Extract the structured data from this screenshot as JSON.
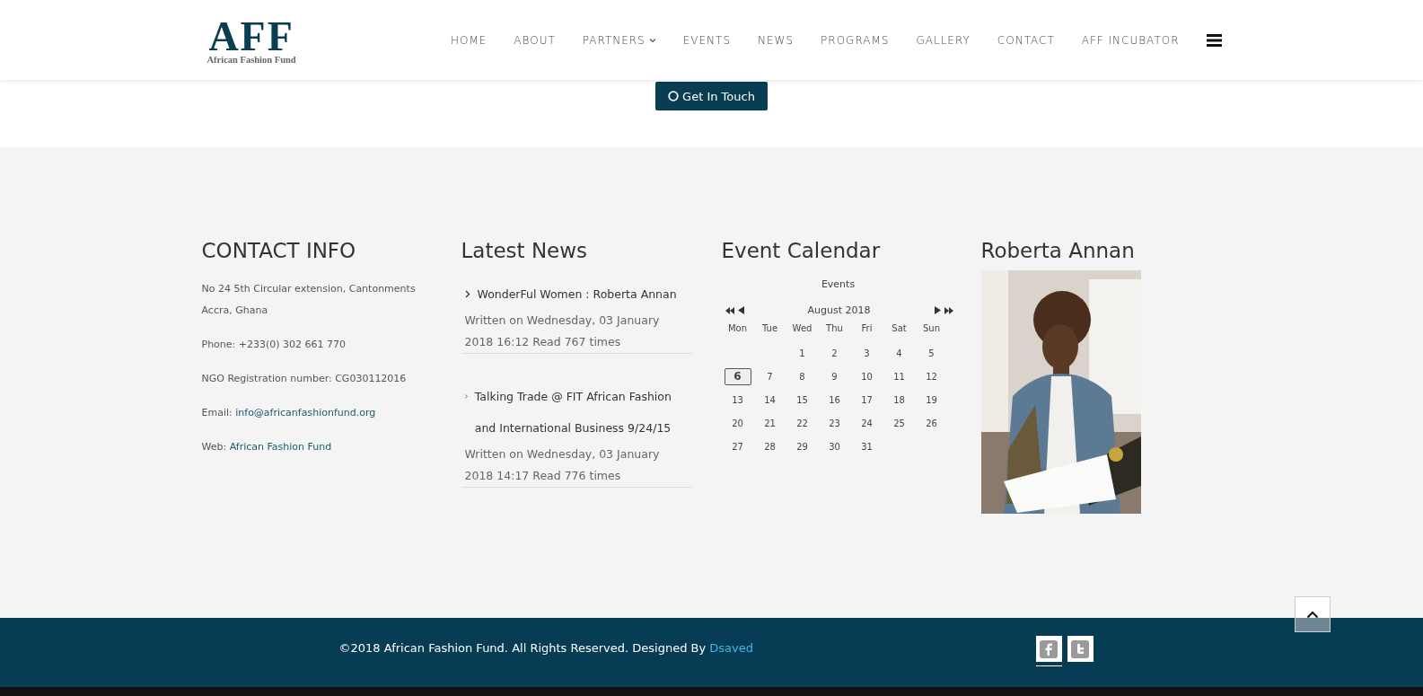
{
  "header": {
    "logo": {
      "mark": "AFF",
      "tagline": "African Fashion Fund"
    },
    "nav": [
      {
        "label": "HOME",
        "dropdown": false
      },
      {
        "label": "ABOUT",
        "dropdown": false
      },
      {
        "label": "PARTNERS",
        "dropdown": true
      },
      {
        "label": "EVENTS",
        "dropdown": false
      },
      {
        "label": "NEWS",
        "dropdown": false
      },
      {
        "label": "PROGRAMS",
        "dropdown": false
      },
      {
        "label": "GALLERY",
        "dropdown": false
      },
      {
        "label": "CONTACT",
        "dropdown": false
      },
      {
        "label": "AFF INCUBATOR",
        "dropdown": false
      }
    ]
  },
  "cta": {
    "label": "Get In Touch"
  },
  "contact": {
    "title": "CONTACT INFO",
    "lines": [
      {
        "text": "No 24 5th Circular extension, Cantonments Accra, Ghana"
      },
      {
        "text": "Phone: +233(0) 302 661 770"
      },
      {
        "text": "NGO Registration number: CG030112016"
      },
      {
        "text": "Email:",
        "link": "info@africanfashionfund.org"
      },
      {
        "text": "Web:",
        "link": "African Fashion Fund"
      }
    ]
  },
  "news": {
    "title": "Latest News",
    "items": [
      {
        "title": "WonderFul Women : Roberta Annan",
        "meta": "Written on Wednesday, 03 January 2018 16:12 Read 767 times"
      },
      {
        "title": "Talking Trade @ FIT African Fashion and International Business 9/24/15",
        "meta": "Written on Wednesday, 03 January 2018 14:17 Read 776 times"
      }
    ]
  },
  "calendar": {
    "title": "Event Calendar",
    "caption": "Events",
    "month": "August 2018",
    "weekdays": [
      "Mon",
      "Tue",
      "Wed",
      "Thu",
      "Fri",
      "Sat",
      "Sun"
    ],
    "weeks": [
      [
        {
          "kind": "empty"
        },
        {
          "kind": "empty"
        },
        {
          "kind": "day",
          "day": "1",
          "selected": false
        },
        {
          "kind": "day",
          "day": "2",
          "selected": false
        },
        {
          "kind": "day",
          "day": "3",
          "selected": false
        },
        {
          "kind": "day",
          "day": "4",
          "selected": false
        },
        {
          "kind": "day",
          "day": "5",
          "selected": false
        }
      ],
      [
        {
          "kind": "day",
          "day": "6",
          "selected": true
        },
        {
          "kind": "day",
          "day": "7",
          "selected": false
        },
        {
          "kind": "day",
          "day": "8",
          "selected": false
        },
        {
          "kind": "day",
          "day": "9",
          "selected": false
        },
        {
          "kind": "day",
          "day": "10",
          "selected": false
        },
        {
          "kind": "day",
          "day": "11",
          "selected": false
        },
        {
          "kind": "day",
          "day": "12",
          "selected": false
        }
      ],
      [
        {
          "kind": "day",
          "day": "13",
          "selected": false
        },
        {
          "kind": "day",
          "day": "14",
          "selected": false
        },
        {
          "kind": "day",
          "day": "15",
          "selected": false
        },
        {
          "kind": "day",
          "day": "16",
          "selected": false
        },
        {
          "kind": "day",
          "day": "17",
          "selected": false
        },
        {
          "kind": "day",
          "day": "18",
          "selected": false
        },
        {
          "kind": "day",
          "day": "19",
          "selected": false
        }
      ],
      [
        {
          "kind": "day",
          "day": "20",
          "selected": false
        },
        {
          "kind": "day",
          "day": "21",
          "selected": false
        },
        {
          "kind": "day",
          "day": "22",
          "selected": false
        },
        {
          "kind": "day",
          "day": "23",
          "selected": false
        },
        {
          "kind": "day",
          "day": "24",
          "selected": false
        },
        {
          "kind": "day",
          "day": "25",
          "selected": false
        },
        {
          "kind": "day",
          "day": "26",
          "selected": false
        }
      ],
      [
        {
          "kind": "day",
          "day": "27",
          "selected": false
        },
        {
          "kind": "day",
          "day": "28",
          "selected": false
        },
        {
          "kind": "day",
          "day": "29",
          "selected": false
        },
        {
          "kind": "day",
          "day": "30",
          "selected": false
        },
        {
          "kind": "day",
          "day": "31",
          "selected": false
        },
        {
          "kind": "empty"
        },
        {
          "kind": "empty"
        }
      ]
    ]
  },
  "feature": {
    "title": "Roberta Annan"
  },
  "footer": {
    "copyright": "©2018 African Fashion Fund. All Rights Reserved. Designed By",
    "designer": "Dsaved",
    "social": [
      {
        "kind": "facebook",
        "selected": true
      },
      {
        "kind": "twitter",
        "selected": false
      }
    ]
  }
}
